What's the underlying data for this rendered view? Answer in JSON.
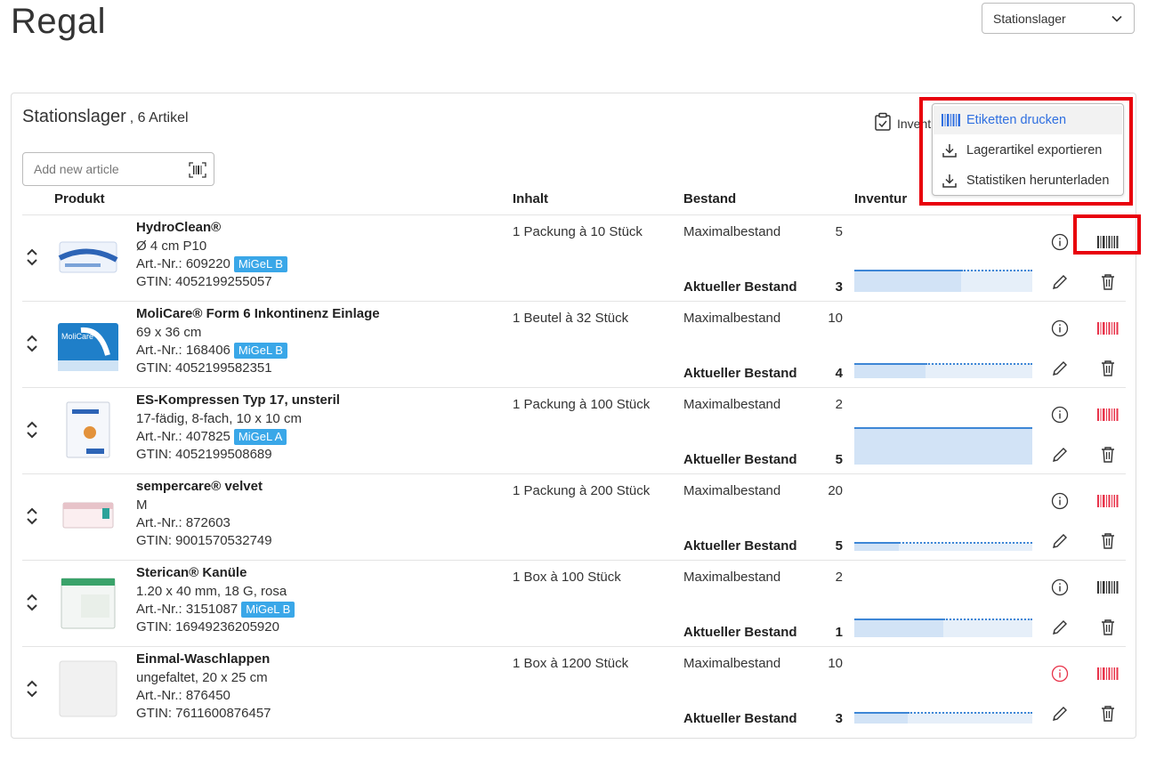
{
  "page": {
    "title": "Regal"
  },
  "location_select": {
    "value": "Stationslager"
  },
  "card": {
    "title": "Stationslager",
    "count": ", 6 Artikel",
    "inventory_label": "Invent"
  },
  "add_article": {
    "placeholder": "Add new article"
  },
  "table": {
    "headers": {
      "product": "Produkt",
      "content": "Inhalt",
      "stock": "Bestand",
      "inventory": "Inventur"
    },
    "max_label": "Maximalbestand",
    "current_label": "Aktueller Bestand"
  },
  "menu": {
    "items": [
      {
        "label": "Etiketten drucken",
        "icon": "barcode-icon",
        "active": true
      },
      {
        "label": "Lagerartikel exportieren",
        "icon": "download-icon"
      },
      {
        "label": "Statistiken herunterladen",
        "icon": "download-icon"
      }
    ]
  },
  "rows": [
    {
      "name": "HydroClean®",
      "line2": "Ø 4 cm P10",
      "art": "Art.-Nr.: 609220",
      "badge": "MiGeL B",
      "gtin": "GTIN: 4052199255057",
      "content": "1 Packung à 10 Stück",
      "max": "5",
      "current": "3",
      "info_alert": false,
      "barcode_color": "#333333"
    },
    {
      "name": "MoliCare® Form 6 Inkontinenz Einlage",
      "line2": "69 x 36 cm",
      "art": "Art.-Nr.: 168406",
      "badge": "MiGeL B",
      "gtin": "GTIN: 4052199582351",
      "content": "1 Beutel à 32 Stück",
      "max": "10",
      "current": "4",
      "info_alert": false,
      "barcode_color": "#e8334a"
    },
    {
      "name": "ES-Kompressen Typ 17, unsteril",
      "line2": "17-fädig, 8-fach, 10 x 10 cm",
      "art": "Art.-Nr.: 407825",
      "badge": "MiGeL A",
      "gtin": "GTIN: 4052199508689",
      "content": "1 Packung à 100 Stück",
      "max": "2",
      "current": "5",
      "info_alert": false,
      "barcode_color": "#e8334a"
    },
    {
      "name": "sempercare® velvet",
      "line2": "M",
      "art": "Art.-Nr.: 872603",
      "badge": "",
      "gtin": "GTIN: 9001570532749",
      "content": "1 Packung à 200 Stück",
      "max": "20",
      "current": "5",
      "info_alert": false,
      "barcode_color": "#e8334a"
    },
    {
      "name": "Sterican® Kanüle",
      "line2": "1.20 x 40 mm, 18 G, rosa",
      "art": "Art.-Nr.: 3151087",
      "badge": "MiGeL B",
      "gtin": "GTIN: 16949236205920",
      "content": "1 Box à 100 Stück",
      "max": "2",
      "current": "1",
      "info_alert": false,
      "barcode_color": "#333333"
    },
    {
      "name": "Einmal-Waschlappen",
      "line2": "ungefaltet, 20 x 25 cm",
      "art": "Art.-Nr.: 876450",
      "badge": "",
      "gtin": "GTIN: 7611600876457",
      "content": "1 Box à 1200 Stück",
      "max": "10",
      "current": "3",
      "info_alert": true,
      "barcode_color": "#e8334a"
    }
  ]
}
